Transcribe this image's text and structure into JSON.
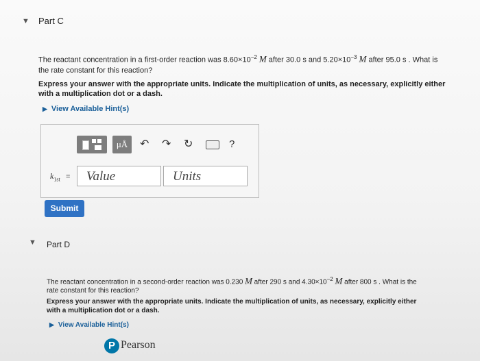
{
  "part_c": {
    "title": "Part C",
    "question_pre": "The reactant concentration in a first-order reaction was 8.60×10",
    "exp1": "−2",
    "unit1": "M",
    "question_mid1": " after 30.0 s and 5.20×10",
    "exp2": "−3",
    "unit2": "M",
    "question_mid2": " after 95.0 s . What is",
    "question_line2": "the rate constant for this reaction?",
    "instruction_line1": "Express your answer with the appropriate units. Indicate the multiplication of units, as necessary, explicitly either",
    "instruction_line2": "with a multiplication dot or a dash.",
    "hint_label": "View Available Hint(s)",
    "toolbar": {
      "mu_label": "μÅ",
      "help_label": "?"
    },
    "answer": {
      "variable": "k",
      "subscript": "1st",
      "equals": "=",
      "value_placeholder": "Value",
      "units_placeholder": "Units"
    },
    "submit_label": "Submit"
  },
  "part_d": {
    "title": "Part D",
    "question_pre": "The reactant concentration in a second-order reaction was 0.230 ",
    "unit1": "M",
    "question_mid1": " after 290 s and 4.30×10",
    "exp1": "−2",
    "unit2": "M",
    "question_mid2": " after 800 s . What is the",
    "question_line2": "rate constant for this reaction?",
    "instruction_line1": "Express your answer with the appropriate units. Indicate the multiplication of units, as necessary, explicitly either",
    "instruction_line2": "with a multiplication dot or a dash.",
    "hint_label": "View Available Hint(s)"
  },
  "footer": {
    "brand_initial": "P",
    "brand_name": "Pearson"
  },
  "colors": {
    "accent_blue": "#2f72c4",
    "link_blue": "#1a5f99",
    "pearson_blue": "#0076a8"
  }
}
